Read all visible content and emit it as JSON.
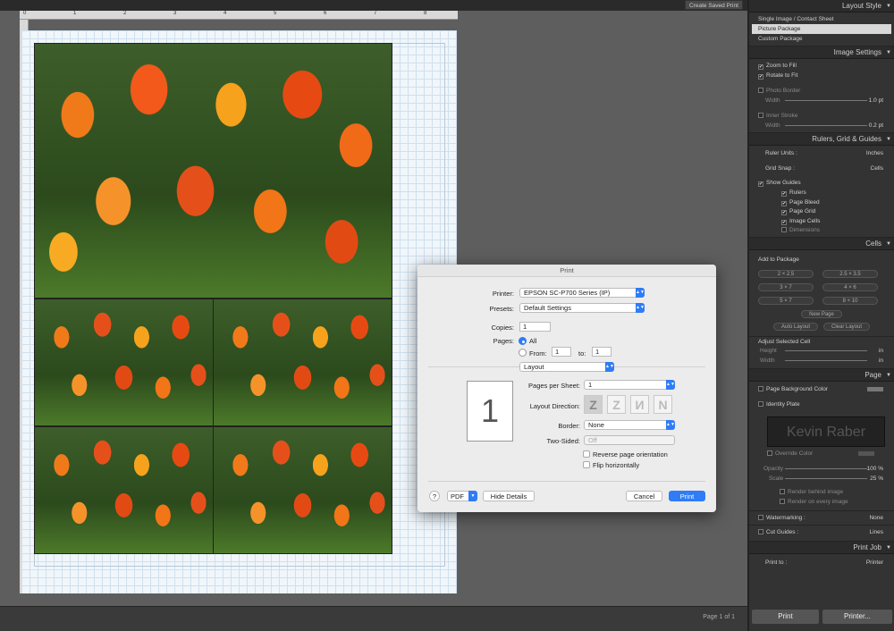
{
  "toolbar": {
    "create_saved_print": "Create Saved Print"
  },
  "ruler": {
    "ticks": [
      "0",
      "1",
      "2",
      "3",
      "4",
      "5",
      "6",
      "7",
      "8"
    ]
  },
  "status": {
    "page_info": "Page 1 of 1"
  },
  "dialog": {
    "title": "Print",
    "printer_label": "Printer:",
    "printer_value": "EPSON SC-P700 Series (IP)",
    "presets_label": "Presets:",
    "presets_value": "Default Settings",
    "copies_label": "Copies:",
    "copies_value": "1",
    "pages_label": "Pages:",
    "pages_all": "All",
    "pages_from": "From:",
    "from_value": "1",
    "pages_to": "to:",
    "to_value": "1",
    "section": "Layout",
    "preview_number": "1",
    "pps_label": "Pages per Sheet:",
    "pps_value": "1",
    "direction_label": "Layout Direction:",
    "direction_glyphs": [
      "Z",
      "Z",
      "И",
      "N"
    ],
    "border_label": "Border:",
    "border_value": "None",
    "twosided_label": "Two-Sided:",
    "twosided_value": "Off",
    "reverse": "Reverse page orientation",
    "flip": "Flip horizontally",
    "help": "?",
    "pdf": "PDF",
    "hide_details": "Hide Details",
    "cancel": "Cancel",
    "print": "Print"
  },
  "panel": {
    "layout_style": {
      "header": "Layout Style",
      "items": [
        "Single Image / Contact Sheet",
        "Picture Package",
        "Custom Package"
      ],
      "selected": 1
    },
    "image_settings": {
      "header": "Image Settings",
      "zoom_to_fill": "Zoom to Fill",
      "rotate_to_fit": "Rotate to Fit",
      "photo_border": "Photo Border",
      "width": "Width",
      "border_width_value": "1.0 pt",
      "inner_stroke": "Inner Stroke",
      "stroke_width_value": "0.2 pt"
    },
    "rulers_grid": {
      "header": "Rulers, Grid & Guides",
      "ruler_units": "Ruler Units :",
      "ruler_units_value": "Inches",
      "grid_snap": "Grid Snap :",
      "grid_snap_value": "Cells",
      "show_guides": "Show Guides",
      "guides": [
        "Rulers",
        "Page Bleed",
        "Page Grid",
        "Image Cells",
        "Dimensions"
      ]
    },
    "cells": {
      "header": "Cells",
      "add_to_package": "Add to Package",
      "sizes": [
        "2 × 2.5",
        "2.5 × 3.5",
        "3 × 7",
        "4 × 6",
        "5 × 7",
        "8 × 10"
      ],
      "new_page": "New Page",
      "auto_layout": "Auto Layout",
      "clear_layout": "Clear Layout",
      "adjust_selected": "Adjust Selected Cell",
      "height": "Height",
      "width": "Width",
      "unit": "in"
    },
    "page": {
      "header": "Page",
      "bg_color": "Page Background Color",
      "identity_plate": "Identity Plate",
      "plate_text": "Kevin Raber",
      "override_color": "Override Color",
      "opacity": "Opacity",
      "opacity_value": "100 %",
      "scale": "Scale",
      "scale_value": "25 %",
      "render_behind": "Render behind image",
      "render_every": "Render on every image",
      "watermarking": "Watermarking :",
      "watermarking_value": "None",
      "cut_guides": "Cut Guides :",
      "cut_guides_value": "Lines"
    },
    "print_job": {
      "header": "Print Job",
      "print_to": "Print to :",
      "print_to_value": "Printer",
      "print_btn": "Print",
      "printer_btn": "Printer..."
    }
  }
}
